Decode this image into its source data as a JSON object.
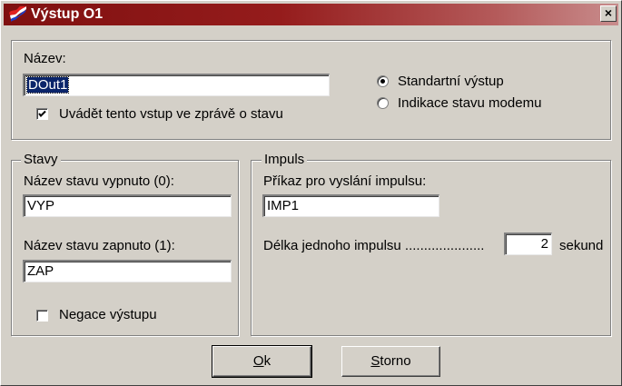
{
  "window": {
    "title": "Výstup O1",
    "close_symbol": "×",
    "title_icon": "flag-icon"
  },
  "top": {
    "name_label": "Název:",
    "name_value": "DOut1",
    "report_checkbox": {
      "label": "Uvádět tento vstup ve zprávě o stavu",
      "checked": true
    },
    "radios": [
      {
        "label": "Standartní výstup",
        "selected": true
      },
      {
        "label": "Indikace stavu modemu",
        "selected": false
      }
    ]
  },
  "states": {
    "legend": "Stavy",
    "off_label": "Název stavu vypnuto (0):",
    "off_value": "VYP",
    "on_label": "Název stavu zapnuto (1):",
    "on_value": "ZAP",
    "negate_checkbox": {
      "label": "Negace výstupu",
      "checked": false
    }
  },
  "impulse": {
    "legend": "Impuls",
    "command_label": "Příkaz pro vyslání impulsu:",
    "command_value": "IMP1",
    "length_label": "Délka jednoho impulsu .....................",
    "length_value": "2",
    "length_unit": "sekund"
  },
  "buttons": {
    "ok_mnemonic": "O",
    "ok_rest": "k",
    "cancel_mnemonic": "S",
    "cancel_rest": "torno"
  }
}
